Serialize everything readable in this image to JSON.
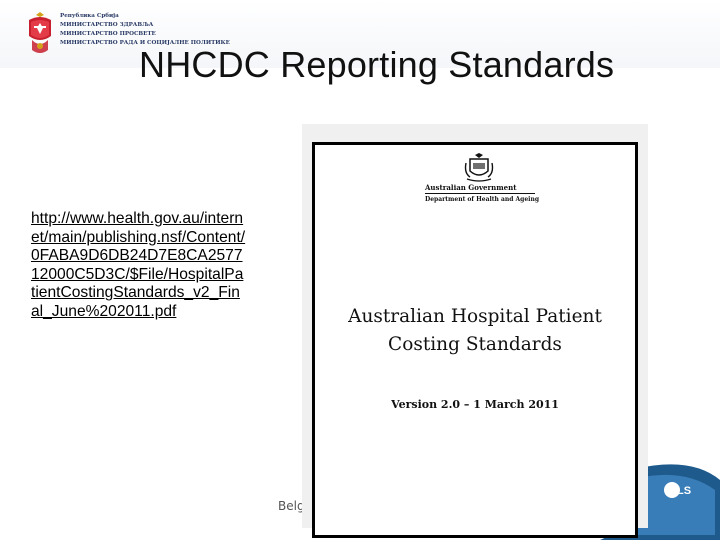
{
  "header": {
    "ministry_lines": [
      "Република Србија",
      "МИНИСТАРСТВО ЗДРАВЉА",
      "МИНИСТАРСТВО ПРОСВЕТЕ",
      "МИНИСТАРСТВО РАДА И СОЦИЈАЛНЕ ПОЛИТИКЕ"
    ]
  },
  "title": "NHCDC Reporting Standards",
  "link": "http://www.health.gov.au/internet/main/publishing.nsf/Content/0FABA9D6DB24D7E8CA257712000C5D3C/$File/HospitalPatientCostingStandards_v2_Final_June%202011.pdf",
  "document": {
    "government": "Australian Government",
    "department": "Department of Health and Ageing",
    "title_line1": "Australian Hospital Patient",
    "title_line2": "Costing Standards",
    "version": "Version 2.0 – 1 March 2011"
  },
  "footer": {
    "text": "Belgr"
  },
  "colors": {
    "ministry_text": "#2a3b66",
    "footer_swoosh": "#1e5a8c",
    "coat_red": "#c8202f"
  },
  "icons": {
    "coat_of_arms": "serbian-coat-of-arms-icon",
    "emblem": "australian-coat-of-arms-icon",
    "swoosh": "dils-swoosh-icon"
  }
}
